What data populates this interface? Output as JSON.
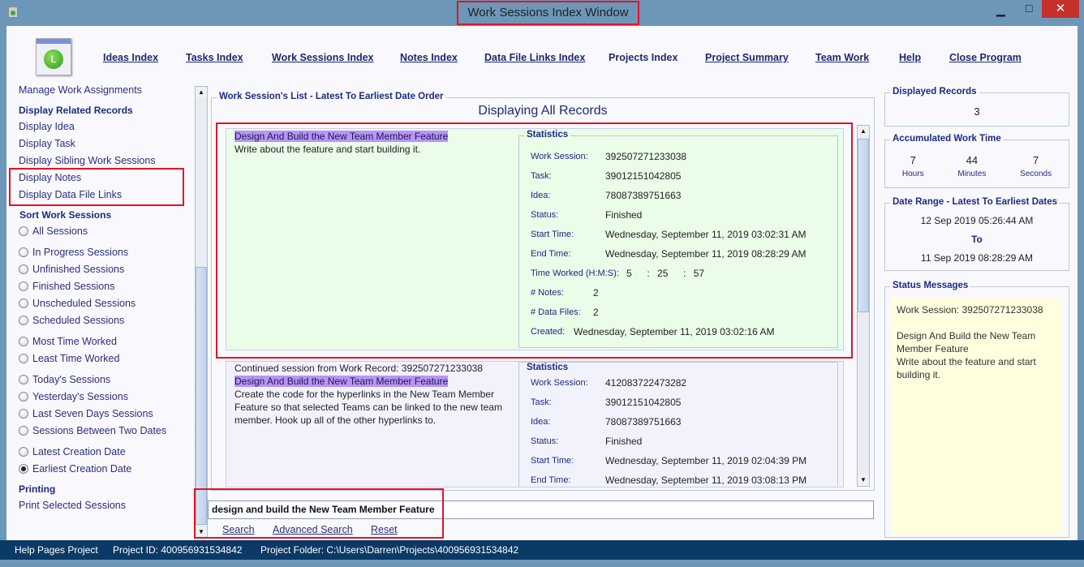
{
  "window": {
    "title": "Work Sessions Index Window",
    "minimize": "▁",
    "maximize": "□",
    "close": "✕"
  },
  "nav": [
    "Ideas Index",
    "Tasks Index",
    "Work Sessions Index",
    "Notes Index",
    "Data File Links Index",
    "Projects Index",
    "Project Summary",
    "Team Work",
    "Help",
    "Close Program"
  ],
  "sidebar": {
    "manage": "Manage Work Assignments",
    "related_heading": "Display Related Records",
    "related": [
      "Display Idea",
      "Display Task",
      "Display Sibling Work Sessions",
      "Display Notes",
      "Display Data File Links"
    ],
    "sort_heading": "Sort Work Sessions",
    "sort": [
      {
        "label": "All Sessions",
        "checked": false
      },
      {
        "label": "In Progress Sessions",
        "checked": false
      },
      {
        "label": "Unfinished Sessions",
        "checked": false
      },
      {
        "label": "Finished Sessions",
        "checked": false
      },
      {
        "label": "Unscheduled Sessions",
        "checked": false
      },
      {
        "label": "Scheduled Sessions",
        "checked": false
      },
      {
        "label": "Most Time Worked",
        "checked": false
      },
      {
        "label": "Least Time Worked",
        "checked": false
      },
      {
        "label": "Today's Sessions",
        "checked": false
      },
      {
        "label": "Yesterday's Sessions",
        "checked": false
      },
      {
        "label": "Last Seven Days Sessions",
        "checked": false
      },
      {
        "label": "Sessions Between Two Dates",
        "checked": false
      },
      {
        "label": "Latest Creation Date",
        "checked": false
      },
      {
        "label": "Earliest Creation Date",
        "checked": true
      }
    ],
    "printing_heading": "Printing",
    "print": "Print Selected Sessions"
  },
  "list": {
    "group_title": "Work Session's List - Latest To Earliest Date Order",
    "heading": "Displaying All Records",
    "stats_title": "Statistics",
    "labels": {
      "session": "Work Session:",
      "task": "Task:",
      "idea": "Idea:",
      "status": "Status:",
      "start": "Start Time:",
      "end": "End Time:",
      "worked": "Time Worked (H:M:S):",
      "notes": "# Notes:",
      "files": "# Data Files:",
      "created": "Created:"
    },
    "records": [
      {
        "prefix": "",
        "title": "Design And Build the New Team Member Feature",
        "description": "Write about the feature and start building it.",
        "session": "392507271233038",
        "task": "39012151042805",
        "idea": "78087389751663",
        "status": "Finished",
        "start": "Wednesday, September 11, 2019   03:02:31 AM",
        "end": "Wednesday, September 11, 2019   08:28:29 AM",
        "h": "5",
        "m": "25",
        "s": "57",
        "notes": "2",
        "files": "2",
        "created": "Wednesday, September 11, 2019   03:02:16 AM",
        "bg": "#e9fde9"
      },
      {
        "prefix": "Continued session from Work Record: 392507271233038",
        "title": "Design And Build the New Team Member Feature",
        "description": "Create the code for the hyperlinks in the New Team Member Feature so that selected Teams can be linked to the new team member. Hook up all of the other hyperlinks to.",
        "session": "412083722473282",
        "task": "39012151042805",
        "idea": "78087389751663",
        "status": "Finished",
        "start": "Wednesday, September 11, 2019   02:04:39 PM",
        "end": "Wednesday, September 11, 2019   03:08:13 PM",
        "bg": "#f2f2fd"
      }
    ]
  },
  "search": {
    "value": "design and build the New Team Member Feature",
    "search": "Search",
    "advanced": "Advanced Search",
    "reset": "Reset"
  },
  "right": {
    "displayed_title": "Displayed Records",
    "displayed": "3",
    "accum_title": "Accumulated Work Time",
    "hours": "7",
    "hours_label": "Hours",
    "minutes": "44",
    "minutes_label": "Minutes",
    "seconds": "7",
    "seconds_label": "Seconds",
    "range_title": "Date Range - Latest To Earliest Dates",
    "range_start": "12 Sep 2019  05:26:44 AM",
    "range_to": "To",
    "range_end": "11 Sep 2019  08:28:29 AM",
    "status_title": "Status Messages",
    "status_line1": "Work Session: 392507271233038",
    "status_line2": "Design And Build the New Team Member Feature",
    "status_line3": "Write about the feature and start building it."
  },
  "statusbar": {
    "project": "Help Pages Project",
    "id": "Project ID:  400956931534842",
    "folder": "Project Folder: C:\\Users\\Darren\\Projects\\400956931534842"
  },
  "colors": {
    "highlight": "#e81123",
    "titlebar": "#6d97b9",
    "statusbar": "#0b3a66",
    "record_selected": "#e9fde9",
    "status_bg": "#ffffe0"
  }
}
